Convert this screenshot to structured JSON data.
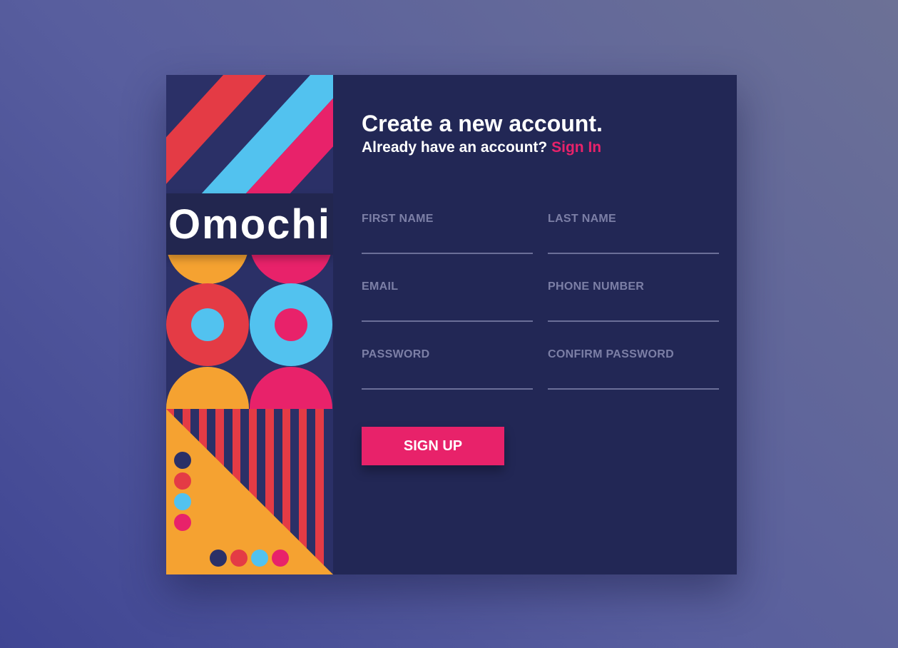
{
  "brand": {
    "name": "Omochi"
  },
  "form": {
    "heading": "Create a new account.",
    "subheading": "Already have an account?",
    "signin_label": "Sign In",
    "fields": {
      "first_name": {
        "label": "FIRST NAME",
        "value": ""
      },
      "last_name": {
        "label": "LAST NAME",
        "value": ""
      },
      "email": {
        "label": "EMAIL",
        "value": ""
      },
      "phone_number": {
        "label": "PHONE NUMBER",
        "value": ""
      },
      "password": {
        "label": "PASSWORD",
        "value": ""
      },
      "confirm_password": {
        "label": "CONFIRM PASSWORD",
        "value": ""
      }
    },
    "submit_label": "SIGN UP"
  },
  "colors": {
    "background_start": "#3f4593",
    "background_end": "#6c7196",
    "panel": "#222755",
    "accent_pink": "#e8226a",
    "accent_red": "#e43b45",
    "accent_blue": "#52c2ef",
    "accent_orange": "#f5a231",
    "art_navy": "#2b3067",
    "field_label": "#7c7fa6"
  }
}
